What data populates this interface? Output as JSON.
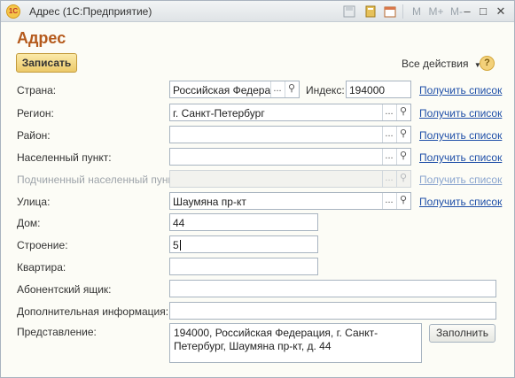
{
  "window": {
    "title": "Адрес  (1С:Предприятие)",
    "icons": [
      "save-icon",
      "calculator-icon",
      "calendar-icon"
    ],
    "memory_buttons": [
      "M",
      "M+",
      "M-"
    ],
    "controls": [
      "minimize-icon",
      "maximize-icon",
      "close-icon"
    ]
  },
  "form": {
    "title": "Адрес",
    "save_button": "Записать",
    "all_actions": "Все действия",
    "help": "?"
  },
  "fields": {
    "country": {
      "label": "Страна:",
      "value": "Российская Федерац"
    },
    "index": {
      "label": "Индекс:",
      "value": "194000"
    },
    "region": {
      "label": "Регион:",
      "value": "г. Санкт-Петербург"
    },
    "district": {
      "label": "Район:",
      "value": ""
    },
    "settlement": {
      "label": "Населенный пункт:",
      "value": ""
    },
    "sub_settlement": {
      "label": "Подчиненный населенный пункт:",
      "value": ""
    },
    "street": {
      "label": "Улица:",
      "value": "Шаумяна пр-кт"
    },
    "house": {
      "label": "Дом:",
      "value": "44"
    },
    "building": {
      "label": "Строение:",
      "value": "5"
    },
    "apartment": {
      "label": "Квартира:",
      "value": ""
    },
    "po_box": {
      "label": "Абонентский ящик:",
      "value": ""
    },
    "extra_info": {
      "label": "Дополнительная информация:",
      "value": ""
    },
    "presentation": {
      "label": "Представление:",
      "value": "194000, Российская Федерация, г. Санкт-Петербург, Шаумяна пр-кт, д. 44"
    }
  },
  "links": {
    "get_list": "Получить список"
  },
  "buttons": {
    "fill": "Заполнить",
    "select": "...",
    "search_icon": "magnifier-icon"
  },
  "colors": {
    "title": "#b55a1c",
    "link": "#1f4fa8",
    "save_bg": "#ecc969"
  }
}
